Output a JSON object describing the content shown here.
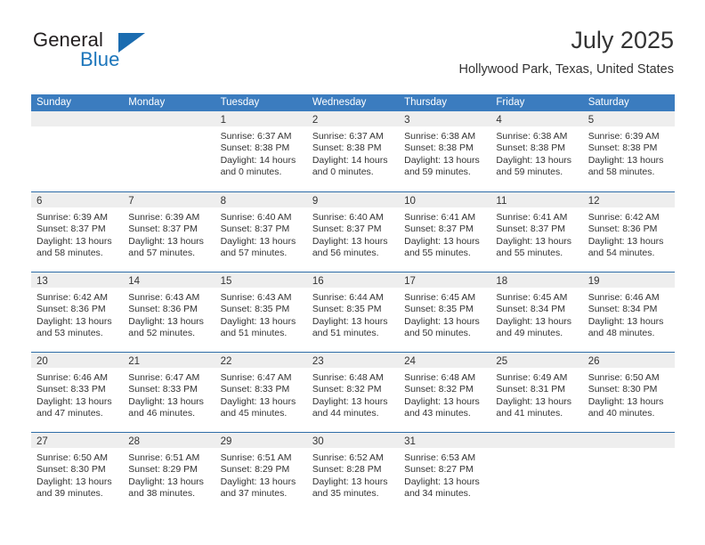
{
  "brand": {
    "name_part1": "General",
    "name_part2": "Blue",
    "accent_color": "#1b75bb",
    "triangle_color": "#1b6cb0"
  },
  "header": {
    "title": "July 2025",
    "subtitle": "Hollywood Park, Texas, United States"
  },
  "calendar": {
    "header_bg": "#3b7cbf",
    "row_border_color": "#2e6da8",
    "daynum_band_color": "#eeeeee",
    "weekdays": [
      "Sunday",
      "Monday",
      "Tuesday",
      "Wednesday",
      "Thursday",
      "Friday",
      "Saturday"
    ],
    "weeks": [
      [
        {
          "day": "",
          "sunrise": "",
          "sunset": "",
          "daylight": ""
        },
        {
          "day": "",
          "sunrise": "",
          "sunset": "",
          "daylight": ""
        },
        {
          "day": "1",
          "sunrise": "Sunrise: 6:37 AM",
          "sunset": "Sunset: 8:38 PM",
          "daylight": "Daylight: 14 hours and 0 minutes."
        },
        {
          "day": "2",
          "sunrise": "Sunrise: 6:37 AM",
          "sunset": "Sunset: 8:38 PM",
          "daylight": "Daylight: 14 hours and 0 minutes."
        },
        {
          "day": "3",
          "sunrise": "Sunrise: 6:38 AM",
          "sunset": "Sunset: 8:38 PM",
          "daylight": "Daylight: 13 hours and 59 minutes."
        },
        {
          "day": "4",
          "sunrise": "Sunrise: 6:38 AM",
          "sunset": "Sunset: 8:38 PM",
          "daylight": "Daylight: 13 hours and 59 minutes."
        },
        {
          "day": "5",
          "sunrise": "Sunrise: 6:39 AM",
          "sunset": "Sunset: 8:38 PM",
          "daylight": "Daylight: 13 hours and 58 minutes."
        }
      ],
      [
        {
          "day": "6",
          "sunrise": "Sunrise: 6:39 AM",
          "sunset": "Sunset: 8:37 PM",
          "daylight": "Daylight: 13 hours and 58 minutes."
        },
        {
          "day": "7",
          "sunrise": "Sunrise: 6:39 AM",
          "sunset": "Sunset: 8:37 PM",
          "daylight": "Daylight: 13 hours and 57 minutes."
        },
        {
          "day": "8",
          "sunrise": "Sunrise: 6:40 AM",
          "sunset": "Sunset: 8:37 PM",
          "daylight": "Daylight: 13 hours and 57 minutes."
        },
        {
          "day": "9",
          "sunrise": "Sunrise: 6:40 AM",
          "sunset": "Sunset: 8:37 PM",
          "daylight": "Daylight: 13 hours and 56 minutes."
        },
        {
          "day": "10",
          "sunrise": "Sunrise: 6:41 AM",
          "sunset": "Sunset: 8:37 PM",
          "daylight": "Daylight: 13 hours and 55 minutes."
        },
        {
          "day": "11",
          "sunrise": "Sunrise: 6:41 AM",
          "sunset": "Sunset: 8:37 PM",
          "daylight": "Daylight: 13 hours and 55 minutes."
        },
        {
          "day": "12",
          "sunrise": "Sunrise: 6:42 AM",
          "sunset": "Sunset: 8:36 PM",
          "daylight": "Daylight: 13 hours and 54 minutes."
        }
      ],
      [
        {
          "day": "13",
          "sunrise": "Sunrise: 6:42 AM",
          "sunset": "Sunset: 8:36 PM",
          "daylight": "Daylight: 13 hours and 53 minutes."
        },
        {
          "day": "14",
          "sunrise": "Sunrise: 6:43 AM",
          "sunset": "Sunset: 8:36 PM",
          "daylight": "Daylight: 13 hours and 52 minutes."
        },
        {
          "day": "15",
          "sunrise": "Sunrise: 6:43 AM",
          "sunset": "Sunset: 8:35 PM",
          "daylight": "Daylight: 13 hours and 51 minutes."
        },
        {
          "day": "16",
          "sunrise": "Sunrise: 6:44 AM",
          "sunset": "Sunset: 8:35 PM",
          "daylight": "Daylight: 13 hours and 51 minutes."
        },
        {
          "day": "17",
          "sunrise": "Sunrise: 6:45 AM",
          "sunset": "Sunset: 8:35 PM",
          "daylight": "Daylight: 13 hours and 50 minutes."
        },
        {
          "day": "18",
          "sunrise": "Sunrise: 6:45 AM",
          "sunset": "Sunset: 8:34 PM",
          "daylight": "Daylight: 13 hours and 49 minutes."
        },
        {
          "day": "19",
          "sunrise": "Sunrise: 6:46 AM",
          "sunset": "Sunset: 8:34 PM",
          "daylight": "Daylight: 13 hours and 48 minutes."
        }
      ],
      [
        {
          "day": "20",
          "sunrise": "Sunrise: 6:46 AM",
          "sunset": "Sunset: 8:33 PM",
          "daylight": "Daylight: 13 hours and 47 minutes."
        },
        {
          "day": "21",
          "sunrise": "Sunrise: 6:47 AM",
          "sunset": "Sunset: 8:33 PM",
          "daylight": "Daylight: 13 hours and 46 minutes."
        },
        {
          "day": "22",
          "sunrise": "Sunrise: 6:47 AM",
          "sunset": "Sunset: 8:33 PM",
          "daylight": "Daylight: 13 hours and 45 minutes."
        },
        {
          "day": "23",
          "sunrise": "Sunrise: 6:48 AM",
          "sunset": "Sunset: 8:32 PM",
          "daylight": "Daylight: 13 hours and 44 minutes."
        },
        {
          "day": "24",
          "sunrise": "Sunrise: 6:48 AM",
          "sunset": "Sunset: 8:32 PM",
          "daylight": "Daylight: 13 hours and 43 minutes."
        },
        {
          "day": "25",
          "sunrise": "Sunrise: 6:49 AM",
          "sunset": "Sunset: 8:31 PM",
          "daylight": "Daylight: 13 hours and 41 minutes."
        },
        {
          "day": "26",
          "sunrise": "Sunrise: 6:50 AM",
          "sunset": "Sunset: 8:30 PM",
          "daylight": "Daylight: 13 hours and 40 minutes."
        }
      ],
      [
        {
          "day": "27",
          "sunrise": "Sunrise: 6:50 AM",
          "sunset": "Sunset: 8:30 PM",
          "daylight": "Daylight: 13 hours and 39 minutes."
        },
        {
          "day": "28",
          "sunrise": "Sunrise: 6:51 AM",
          "sunset": "Sunset: 8:29 PM",
          "daylight": "Daylight: 13 hours and 38 minutes."
        },
        {
          "day": "29",
          "sunrise": "Sunrise: 6:51 AM",
          "sunset": "Sunset: 8:29 PM",
          "daylight": "Daylight: 13 hours and 37 minutes."
        },
        {
          "day": "30",
          "sunrise": "Sunrise: 6:52 AM",
          "sunset": "Sunset: 8:28 PM",
          "daylight": "Daylight: 13 hours and 35 minutes."
        },
        {
          "day": "31",
          "sunrise": "Sunrise: 6:53 AM",
          "sunset": "Sunset: 8:27 PM",
          "daylight": "Daylight: 13 hours and 34 minutes."
        },
        {
          "day": "",
          "sunrise": "",
          "sunset": "",
          "daylight": ""
        },
        {
          "day": "",
          "sunrise": "",
          "sunset": "",
          "daylight": ""
        }
      ]
    ]
  }
}
